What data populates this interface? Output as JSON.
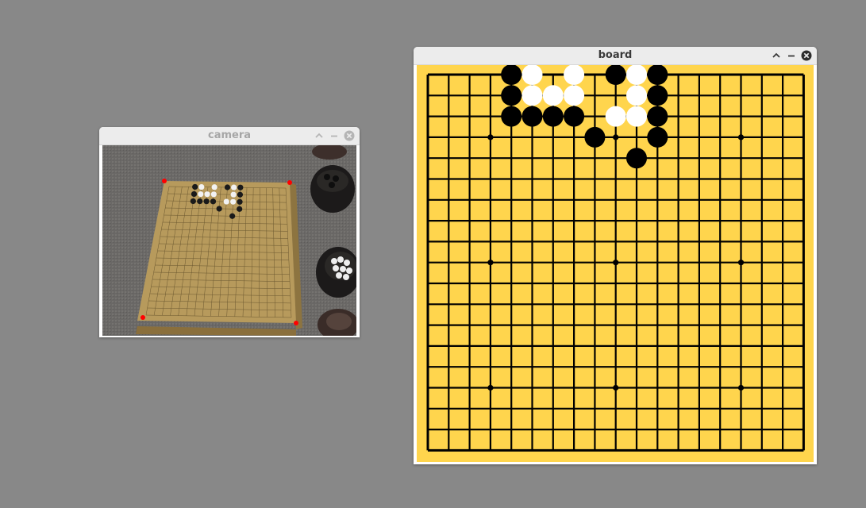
{
  "windows": {
    "camera": {
      "title": "camera",
      "controls": [
        "maximize-icon",
        "minimize-icon",
        "close-icon"
      ]
    },
    "board": {
      "title": "board",
      "controls": [
        "maximize-icon",
        "minimize-icon",
        "close-icon"
      ]
    }
  },
  "colors": {
    "desktop": "#888888",
    "board": "#ffd54d",
    "grid_line": "#000000",
    "black_stone": "#000000",
    "white_stone": "#ffffff",
    "corner_marker": "#ff0000"
  },
  "go_board": {
    "size": 19,
    "star_points": [
      [
        3,
        3
      ],
      [
        3,
        9
      ],
      [
        3,
        15
      ],
      [
        9,
        3
      ],
      [
        9,
        9
      ],
      [
        9,
        15
      ],
      [
        15,
        3
      ],
      [
        15,
        9
      ],
      [
        15,
        15
      ]
    ],
    "black_stones": [
      [
        4,
        0
      ],
      [
        4,
        1
      ],
      [
        4,
        2
      ],
      [
        5,
        2
      ],
      [
        6,
        2
      ],
      [
        7,
        2
      ],
      [
        8,
        3
      ],
      [
        9,
        0
      ],
      [
        11,
        0
      ],
      [
        11,
        1
      ],
      [
        11,
        2
      ],
      [
        11,
        3
      ],
      [
        10,
        4
      ]
    ],
    "white_stones": [
      [
        5,
        0
      ],
      [
        5,
        1
      ],
      [
        6,
        1
      ],
      [
        7,
        0
      ],
      [
        7,
        1
      ],
      [
        9,
        2
      ],
      [
        10,
        0
      ],
      [
        10,
        1
      ],
      [
        10,
        2
      ]
    ]
  }
}
